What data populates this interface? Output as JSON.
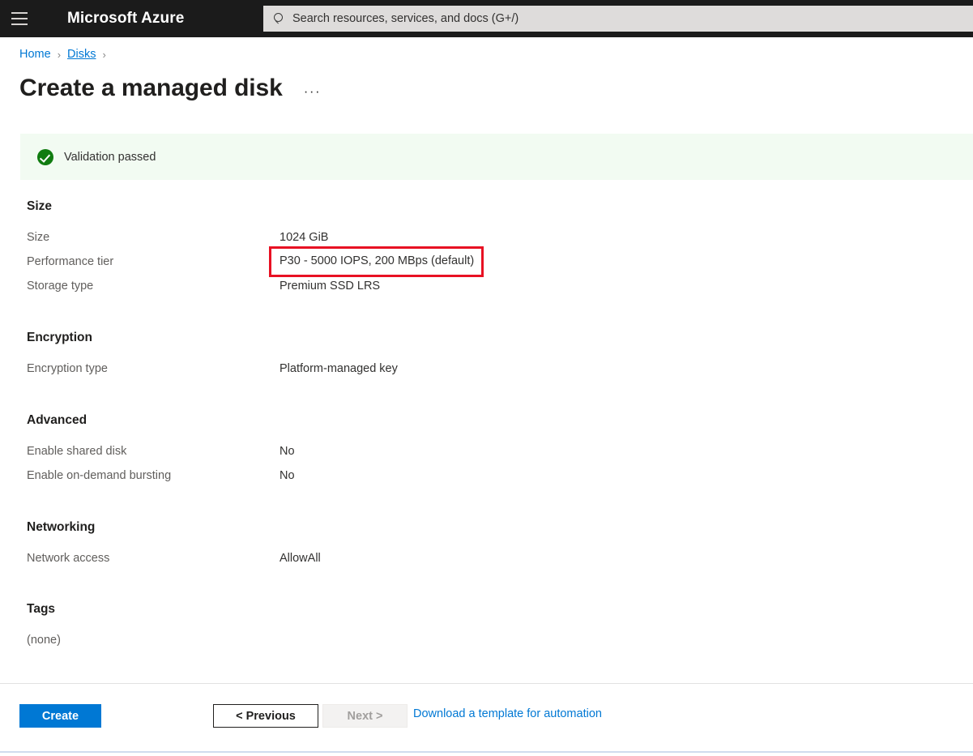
{
  "topbar": {
    "menu_icon": "hamburger-menu-icon",
    "brand": "Microsoft Azure",
    "search": {
      "icon": "search-icon",
      "placeholder": "Search resources, services, and docs (G+/)",
      "value": ""
    }
  },
  "breadcrumb": {
    "items": [
      {
        "label": "Home",
        "hovered": false
      },
      {
        "label": "Disks",
        "hovered": true
      }
    ],
    "separator": "›"
  },
  "page": {
    "title": "Create a managed disk",
    "more_actions": "···"
  },
  "validation": {
    "icon": "check-circle-icon",
    "text": "Validation passed",
    "background": "#f2fbf2",
    "accent": "#107c10"
  },
  "sections": [
    {
      "heading": "Size",
      "rows": [
        {
          "label": "Size",
          "value": "1024 GiB",
          "highlighted": false
        },
        {
          "label": "Performance tier",
          "value": "P30 - 5000 IOPS, 200 MBps (default)",
          "highlighted": true
        },
        {
          "label": "Storage type",
          "value": "Premium SSD LRS",
          "highlighted": false
        }
      ]
    },
    {
      "heading": "Encryption",
      "rows": [
        {
          "label": "Encryption type",
          "value": "Platform-managed key",
          "highlighted": false
        }
      ]
    },
    {
      "heading": "Advanced",
      "rows": [
        {
          "label": "Enable shared disk",
          "value": "No",
          "highlighted": false
        },
        {
          "label": "Enable on-demand bursting",
          "value": "No",
          "highlighted": false
        }
      ]
    },
    {
      "heading": "Networking",
      "rows": [
        {
          "label": "Network access",
          "value": "AllowAll",
          "highlighted": false
        }
      ]
    },
    {
      "heading": "Tags",
      "rows": [
        {
          "label": "(none)",
          "value": "",
          "highlighted": false
        }
      ]
    }
  ],
  "footer": {
    "create_label": "Create",
    "previous_label": "< Previous",
    "next_label": "Next >",
    "next_disabled": true,
    "download_label": "Download a template for automation"
  },
  "colors": {
    "accent": "#0078d4",
    "topbar": "#1b1b1b",
    "highlight_box": "#e81123",
    "success": "#107c10"
  }
}
